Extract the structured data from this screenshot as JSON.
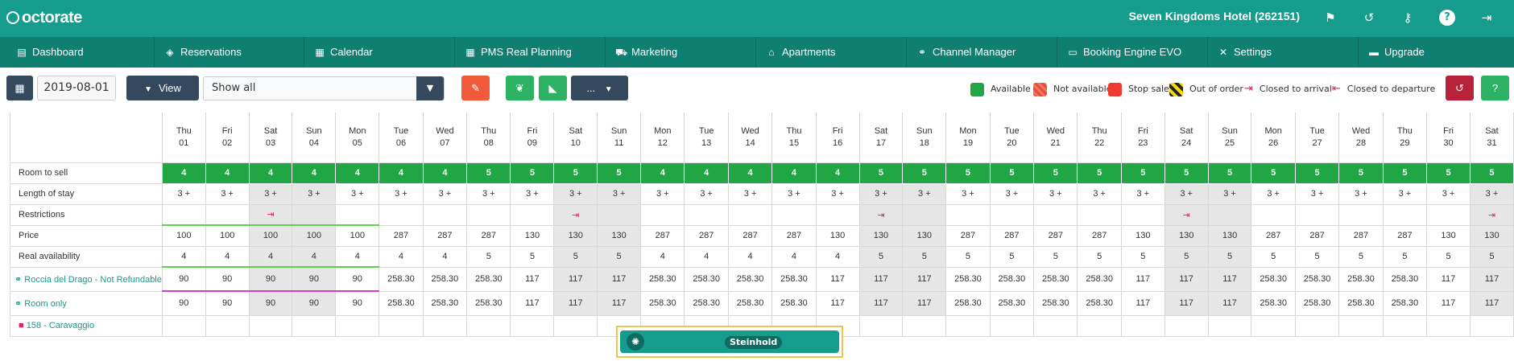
{
  "header": {
    "logo": "octorate",
    "hotel": "Seven Kingdoms Hotel (262151)"
  },
  "nav": [
    "Dashboard",
    "Reservations",
    "Calendar",
    "PMS Real Planning",
    "Marketing",
    "Apartments",
    "Channel Manager",
    "Booking Engine EVO",
    "Settings",
    "Upgrade"
  ],
  "toolbar": {
    "date": "2019-08-01",
    "view_label": "View",
    "select_value": "Show all",
    "more_label": "...",
    "legend": [
      "Available",
      "Not available",
      "Stop sale",
      "Out of order",
      "Closed to arrival",
      "Closed to departure"
    ],
    "help": "?"
  },
  "colors": {
    "teal": "#159c8c",
    "dark_teal": "#0f7f72",
    "green": "#20a645",
    "red": "#e54b4b",
    "stop": "#f03b2f",
    "navy": "#35495e",
    "crimson": "#b7213a"
  },
  "days": [
    {
      "wd": "Thu",
      "d": "01"
    },
    {
      "wd": "Fri",
      "d": "02"
    },
    {
      "wd": "Sat",
      "d": "03"
    },
    {
      "wd": "Sun",
      "d": "04"
    },
    {
      "wd": "Mon",
      "d": "05"
    },
    {
      "wd": "Tue",
      "d": "06"
    },
    {
      "wd": "Wed",
      "d": "07"
    },
    {
      "wd": "Thu",
      "d": "08"
    },
    {
      "wd": "Fri",
      "d": "09"
    },
    {
      "wd": "Sat",
      "d": "10"
    },
    {
      "wd": "Sun",
      "d": "11"
    },
    {
      "wd": "Mon",
      "d": "12"
    },
    {
      "wd": "Tue",
      "d": "13"
    },
    {
      "wd": "Wed",
      "d": "14"
    },
    {
      "wd": "Thu",
      "d": "15"
    },
    {
      "wd": "Fri",
      "d": "16"
    },
    {
      "wd": "Sat",
      "d": "17"
    },
    {
      "wd": "Sun",
      "d": "18"
    },
    {
      "wd": "Mon",
      "d": "19"
    },
    {
      "wd": "Tue",
      "d": "20"
    },
    {
      "wd": "Wed",
      "d": "21"
    },
    {
      "wd": "Thu",
      "d": "22"
    },
    {
      "wd": "Fri",
      "d": "23"
    },
    {
      "wd": "Sat",
      "d": "24"
    },
    {
      "wd": "Sun",
      "d": "25"
    },
    {
      "wd": "Mon",
      "d": "26"
    },
    {
      "wd": "Tue",
      "d": "27"
    },
    {
      "wd": "Wed",
      "d": "28"
    },
    {
      "wd": "Thu",
      "d": "29"
    },
    {
      "wd": "Fri",
      "d": "30"
    },
    {
      "wd": "Sat",
      "d": "31"
    }
  ],
  "rows": {
    "room_to_sell": {
      "label": "Room to sell",
      "values": [
        "4",
        "4",
        "4",
        "4",
        "4",
        "4",
        "4",
        "5",
        "5",
        "5",
        "5",
        "4",
        "4",
        "4",
        "4",
        "4",
        "5",
        "5",
        "5",
        "5",
        "5",
        "5",
        "5",
        "5",
        "5",
        "5",
        "5",
        "5",
        "5",
        "5",
        "5"
      ]
    },
    "length_of_stay": {
      "label": "Length of stay",
      "values": [
        "3 +",
        "3 +",
        "3 +",
        "3 +",
        "3 +",
        "3 +",
        "3 +",
        "3 +",
        "3 +",
        "3 +",
        "3 +",
        "3 +",
        "3 +",
        "3 +",
        "3 +",
        "3 +",
        "3 +",
        "3 +",
        "3 +",
        "3 +",
        "3 +",
        "3 +",
        "3 +",
        "3 +",
        "3 +",
        "3 +",
        "3 +",
        "3 +",
        "3 +",
        "3 +",
        "3 +"
      ]
    },
    "restrictions": {
      "label": "Restrictions",
      "values": [
        "",
        "",
        "x",
        "",
        "",
        "",
        "",
        "",
        "",
        "x",
        "",
        "",
        "",
        "",
        "",
        "",
        "x",
        "",
        "",
        "",
        "",
        "",
        "",
        "x",
        "",
        "",
        "",
        "",
        "",
        "",
        "x"
      ]
    },
    "price": {
      "label": "Price",
      "values": [
        "100",
        "100",
        "100",
        "100",
        "100",
        "287",
        "287",
        "287",
        "130",
        "130",
        "130",
        "287",
        "287",
        "287",
        "287",
        "130",
        "130",
        "130",
        "287",
        "287",
        "287",
        "287",
        "130",
        "130",
        "130",
        "287",
        "287",
        "287",
        "287",
        "130",
        "130"
      ]
    },
    "real_availability": {
      "label": "Real availability",
      "values": [
        "4",
        "4",
        "4",
        "4",
        "4",
        "4",
        "4",
        "5",
        "5",
        "5",
        "5",
        "4",
        "4",
        "4",
        "4",
        "4",
        "5",
        "5",
        "5",
        "5",
        "5",
        "5",
        "5",
        "5",
        "5",
        "5",
        "5",
        "5",
        "5",
        "5",
        "5"
      ]
    },
    "rate1": {
      "label": "Roccia del Drago - Not Refundable",
      "values": [
        "90",
        "90",
        "90",
        "90",
        "90",
        "258.30",
        "258.30",
        "258.30",
        "117",
        "117",
        "117",
        "258.30",
        "258.30",
        "258.30",
        "258.30",
        "117",
        "117",
        "117",
        "258.30",
        "258.30",
        "258.30",
        "258.30",
        "117",
        "117",
        "117",
        "258.30",
        "258.30",
        "258.30",
        "258.30",
        "117",
        "117"
      ]
    },
    "rate2": {
      "label": "Room only",
      "values": [
        "90",
        "90",
        "90",
        "90",
        "90",
        "258.30",
        "258.30",
        "258.30",
        "117",
        "117",
        "117",
        "258.30",
        "258.30",
        "258.30",
        "258.30",
        "117",
        "117",
        "117",
        "258.30",
        "258.30",
        "258.30",
        "258.30",
        "117",
        "117",
        "117",
        "258.30",
        "258.30",
        "258.30",
        "258.30",
        "117",
        "117"
      ]
    },
    "room": {
      "label": "158 - Caravaggio"
    }
  },
  "booking": {
    "guest": "Steinhold"
  }
}
